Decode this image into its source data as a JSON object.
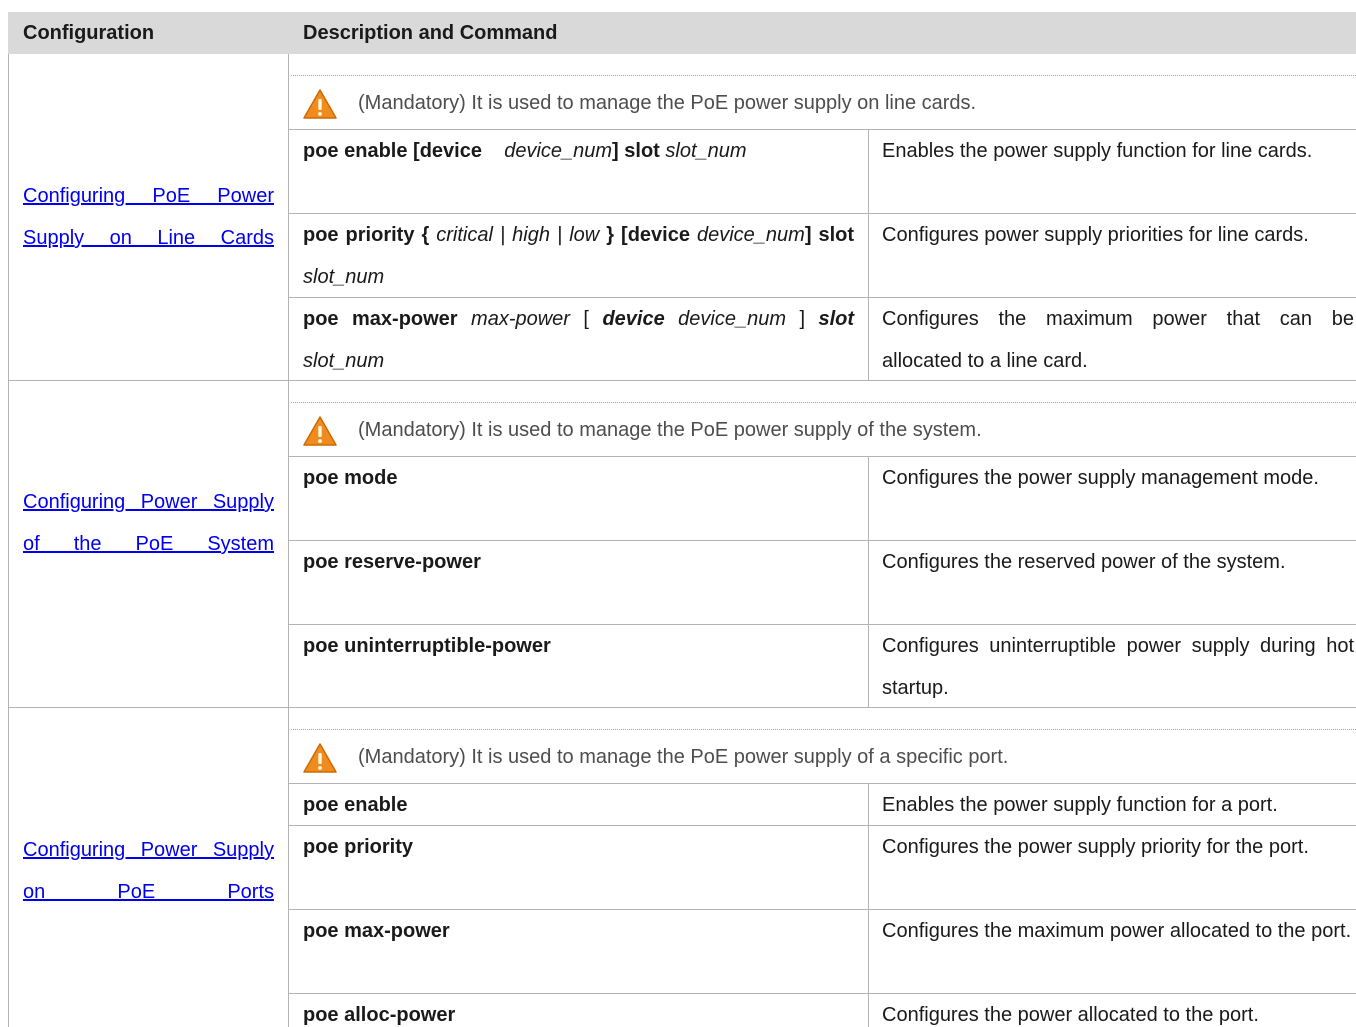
{
  "header": {
    "col1": "Configuration",
    "col2": "Description and Command"
  },
  "sections": [
    {
      "link": "Configuring PoE Power Supply on Line Cards",
      "note": "(Mandatory) It is used to manage the PoE power supply on line cards.",
      "rows": [
        {
          "cmd_parts": [
            "poe enable [device",
            "device_num",
            "] slot",
            "slot_num"
          ],
          "desc": "Enables the power supply function for line cards."
        },
        {
          "cmd_parts": [
            "poe priority {",
            "critical",
            "|",
            "high",
            "|",
            "low",
            "} [device",
            "device_num",
            "] slot",
            "slot_num"
          ],
          "desc": "Configures power supply priorities for line cards."
        },
        {
          "cmd_parts": [
            "poe max-power",
            "max-power",
            "[",
            "device",
            "device_num",
            "]",
            "slot",
            "slot_num"
          ],
          "desc": "Configures the maximum power that can be allocated to a line card."
        }
      ]
    },
    {
      "link": "Configuring Power Supply of the PoE System",
      "note": "(Mandatory) It is used to manage the PoE power supply of the system.",
      "rows": [
        {
          "cmd": "poe mode",
          "desc": "Configures the power supply management mode."
        },
        {
          "cmd": "poe reserve-power",
          "desc": "Configures the reserved power of the system."
        },
        {
          "cmd": "poe uninterruptible-power",
          "desc": "Configures uninterruptible power supply during hot startup."
        }
      ]
    },
    {
      "link": "Configuring Power Supply on PoE Ports",
      "note": "(Mandatory) It is used to manage the PoE power supply of a specific port.",
      "rows": [
        {
          "cmd": "poe enable",
          "desc": "Enables the power supply function for a port."
        },
        {
          "cmd": "poe priority",
          "desc": "Configures the power supply priority for the port."
        },
        {
          "cmd": "poe max-power",
          "desc": "Configures the maximum power allocated to the port."
        },
        {
          "cmd": "poe alloc-power",
          "desc": "Configures the power allocated to the port."
        }
      ]
    }
  ],
  "icons": {
    "warning": "warning-icon",
    "warning_color": "#f08c1e"
  }
}
